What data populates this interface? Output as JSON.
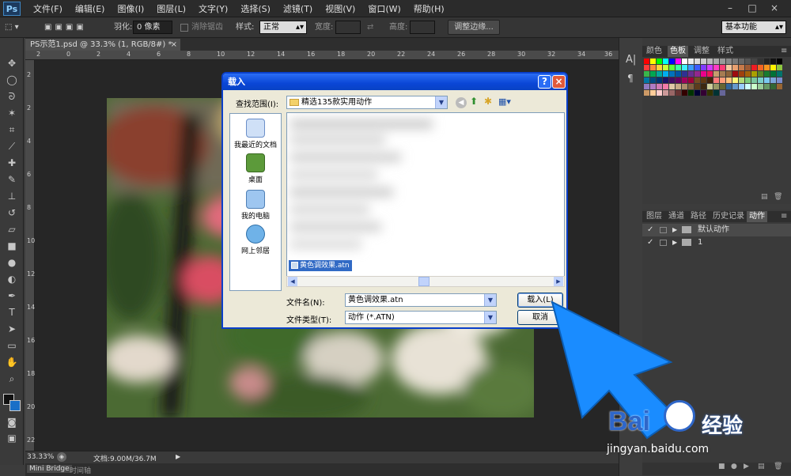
{
  "app": {
    "logo": "Ps",
    "menu": [
      "文件(F)",
      "编辑(E)",
      "图像(I)",
      "图层(L)",
      "文字(Y)",
      "选择(S)",
      "滤镜(T)",
      "视图(V)",
      "窗口(W)",
      "帮助(H)"
    ],
    "window_controls": [
      "–",
      "□",
      "×"
    ]
  },
  "options": {
    "feather_label": "羽化:",
    "feather_value": "0 像素",
    "antialias_label": "消除锯齿",
    "style_label": "样式:",
    "style_value": "正常",
    "width_label": "宽度:",
    "height_label": "高度:",
    "refine_button": "调整边缘...",
    "workspace_value": "基本功能"
  },
  "document": {
    "tab_title": "PS示范1.psd @ 33.3% (1, RGB/8#) *",
    "tab_close": "×",
    "ruler_top": [
      "2",
      "0",
      "2",
      "4",
      "6",
      "8",
      "10",
      "12",
      "14",
      "16",
      "18",
      "20",
      "22",
      "24",
      "26",
      "28",
      "30",
      "32",
      "34",
      "36"
    ],
    "ruler_left": [
      "2",
      "2",
      "4",
      "6",
      "8",
      "10",
      "12",
      "14",
      "16",
      "18",
      "20",
      "22"
    ]
  },
  "status": {
    "zoom": "33.33%",
    "doc_info": "文档:9.00M/36.7M"
  },
  "bottom_tabs": [
    "Mini Bridge",
    "时间轴"
  ],
  "right_panel": {
    "swatch_tabs": [
      "颜色",
      "色板",
      "调整",
      "样式"
    ],
    "swatch_active": "色板",
    "swatch_colors": [
      "#ff0000",
      "#ffff00",
      "#00ff00",
      "#00ffff",
      "#0000ff",
      "#ff00ff",
      "#ffffff",
      "#eeeeee",
      "#dddddd",
      "#cccccc",
      "#bbbbbb",
      "#aaaaaa",
      "#999999",
      "#888888",
      "#777777",
      "#666666",
      "#555555",
      "#444444",
      "#333333",
      "#222222",
      "#111111",
      "#000000",
      "#ff3b3b",
      "#ff8a3b",
      "#ffd43b",
      "#c8ff3b",
      "#5cff3b",
      "#3bffa1",
      "#3bf0ff",
      "#3b9cff",
      "#3b5cff",
      "#7f3bff",
      "#d13bff",
      "#ff3bc4",
      "#ff3b75",
      "#f5c6a0",
      "#e8a070",
      "#c77a4a",
      "#9e5a33",
      "#ee1c24",
      "#f26522",
      "#f7941d",
      "#fff200",
      "#8dc63f",
      "#39b54a",
      "#00a651",
      "#00a99d",
      "#00aeef",
      "#0072bc",
      "#0054a6",
      "#2e3192",
      "#662d91",
      "#92278f",
      "#ec008c",
      "#ed145b",
      "#c69c6d",
      "#a67c52",
      "#8c6239",
      "#9e0b0f",
      "#a0410d",
      "#a36209",
      "#aba000",
      "#598527",
      "#197b30",
      "#007236",
      "#00746b",
      "#0076a3",
      "#004a80",
      "#003471",
      "#1b1464",
      "#440e62",
      "#630460",
      "#9e005d",
      "#9e0039",
      "#754c24",
      "#603913",
      "#42210b",
      "#ff7b7b",
      "#ff9f7b",
      "#ffc27b",
      "#fff57b",
      "#b3dc7b",
      "#7bcc7b",
      "#7bc8a0",
      "#7bd0cc",
      "#7bc9f2",
      "#7ba6d9",
      "#7b8ccc",
      "#8f7bc0",
      "#b07bc4",
      "#d17bb5",
      "#f27ba8",
      "#e0c9a6",
      "#c8ab87",
      "#ad8c6a",
      "#806040",
      "#5c3c1c",
      "#3c2810",
      "#cccc99",
      "#999966",
      "#666633",
      "#336699",
      "#6699cc",
      "#99ccff",
      "#ccffff",
      "#ccffcc",
      "#99cc99",
      "#669966",
      "#336633",
      "#996633",
      "#cc9966",
      "#ffcc99",
      "#ffcccc",
      "#cc9999",
      "#996666",
      "#663333",
      "#330000",
      "#003300",
      "#000033",
      "#330033",
      "#333300",
      "#003333",
      "#666699"
    ],
    "lower_tabs": [
      "图层",
      "通道",
      "路径",
      "历史记录",
      "动作"
    ],
    "lower_active": "动作",
    "actions": [
      {
        "check": "✓",
        "name": "默认动作"
      },
      {
        "check": "✓",
        "name": "1"
      }
    ]
  },
  "dialog": {
    "title": "载入",
    "help": "?",
    "close": "×",
    "lookin_label": "查找范围(I):",
    "lookin_value": "精选135款实用动作",
    "places": [
      "我最近的文档",
      "桌面",
      "我的电脑",
      "网上邻居"
    ],
    "selected_file": "黄色调效果.atn",
    "filename_label": "文件名(N):",
    "filename_value": "黄色调效果.atn",
    "filetype_label": "文件类型(T):",
    "filetype_value": "动作 (*.ATN)",
    "load_button": "载入(L)",
    "cancel_button": "取消"
  },
  "watermark": {
    "brand": "Bai",
    "brand_suffix": "经验",
    "url": "jingyan.baidu.com"
  },
  "colors": {
    "accent_arrow": "#1a8cff",
    "dialog_title": "#0a46d6",
    "baidu_blue": "#2f67c9"
  }
}
